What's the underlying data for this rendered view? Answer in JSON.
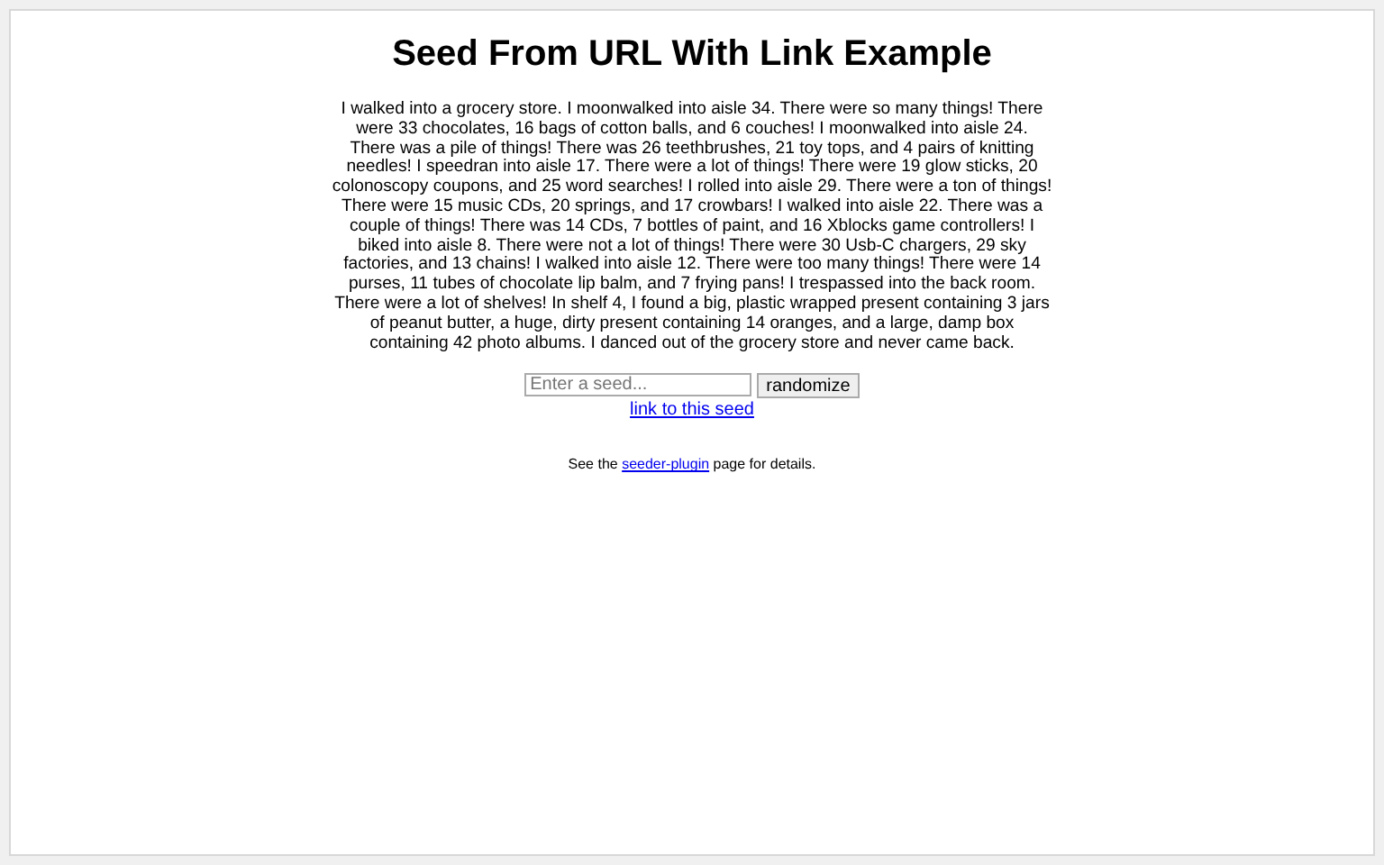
{
  "title": "Seed From URL With Link Example",
  "story": "I walked into a grocery store. I moonwalked into aisle 34. There were so many things! There were 33 chocolates, 16 bags of cotton balls, and 6 couches! I moonwalked into aisle 24. There was a pile of things! There was 26 teethbrushes, 21 toy tops, and 4 pairs of knitting needles! I speedran into aisle 17. There were a lot of things! There were 19 glow sticks, 20 colonoscopy coupons, and 25 word searches! I rolled into aisle 29. There were a ton of things! There were 15 music CDs, 20 springs, and 17 crowbars! I walked into aisle 22. There was a couple of things! There was 14 CDs, 7 bottles of paint, and 16 Xblocks game controllers! I biked into aisle 8. There were not a lot of things! There were 30 Usb-C chargers, 29 sky factories, and 13 chains! I walked into aisle 12. There were too many things! There were 14 purses, 11 tubes of chocolate lip balm, and 7 frying pans! I trespassed into the back room. There were a lot of shelves! In shelf 4, I found a big, plastic wrapped present containing 3 jars of peanut butter, a huge, dirty present containing 14 oranges, and a large, damp box containing 42 photo albums. I danced out of the grocery store and never came back.",
  "seed_field": {
    "placeholder": "Enter a seed..."
  },
  "randomize_button": "randomize",
  "seed_link": "link to this seed",
  "note": {
    "before": "See the",
    "link": "seeder-plugin",
    "after": "page for details."
  }
}
